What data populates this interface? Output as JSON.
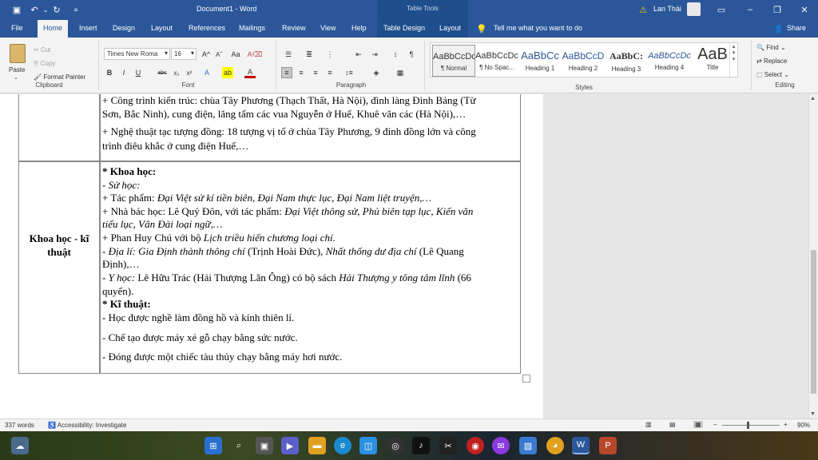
{
  "window": {
    "title": "Document1 - Word",
    "context_tab": "Table Tools",
    "user": "Lan Thái"
  },
  "tabs": [
    "File",
    "Home",
    "Insert",
    "Design",
    "Layout",
    "References",
    "Mailings",
    "Review",
    "View",
    "Help",
    "Table Design",
    "Layout"
  ],
  "tell_me": "Tell me what you want to do",
  "share": "Share",
  "clipboard": {
    "paste": "Paste",
    "cut": "Cut",
    "copy": "Copy",
    "format_painter": "Format Painter",
    "label": "Clipboard"
  },
  "font": {
    "name": "Times New Roma",
    "size": "16",
    "label": "Font"
  },
  "paragraph": {
    "label": "Paragraph"
  },
  "styles": {
    "items": [
      {
        "preview": "AaBbCcDc",
        "name": "¶ Normal"
      },
      {
        "preview": "AaBbCcDc",
        "name": "¶ No Spac..."
      },
      {
        "preview": "AaBbCc",
        "name": "Heading 1"
      },
      {
        "preview": "AaBbCcD",
        "name": "Heading 2"
      },
      {
        "preview": "AaBbC:",
        "name": "Heading 3"
      },
      {
        "preview": "AaBbCcDc",
        "name": "Heading 4"
      },
      {
        "preview": "AaB",
        "name": "Title"
      }
    ],
    "label": "Styles"
  },
  "editing": {
    "find": "Find",
    "replace": "Replace",
    "select": "Select",
    "label": "Editing"
  },
  "doc": {
    "top_lines": [
      "+ Công trình kiến trúc: chùa Tây Phương (Thạch Thất, Hà Nội), đình làng Đình Bảng (Từ",
      "Sơn, Bắc Ninh), cung điện, lăng tẩm các vua Nguyễn ở Huế, Khuê văn các (Hà Nội),…",
      "+ Nghệ thuật tạc tượng đồng: 18 tượng vị tổ ở chùa Tây Phương, 9 đỉnh đồng lớn và công",
      "trình điêu khắc ở cung điện Huế,…"
    ],
    "left_cell": [
      "Khoa học - kĩ",
      "thuật"
    ],
    "science_heading": "* Khoa học:",
    "sub_history": "- Sử học:",
    "works_label": "+ Tác phẩm:",
    "works": " Đại Việt sử kí tiền biên, Đại Nam thực lục, Đại Nam liệt truyện,…",
    "scholar_label": "+ Nhà bác học: Lê Quý Đôn, với tác phẩm:",
    "scholar_works": " Đại Việt thông sử, Phủ biên tạp lục, Kiến văn",
    "scholar_works2": "tiểu lục, Vân Đài loại ngữ,…",
    "phan_prefix": "+ Phan Huy Chú với bộ ",
    "phan_work": "Lịch triều hiến chương loại chí.",
    "geo_prefix": "- Địa lí: Gia Định thành thông chí",
    "geo_mid": " (Trịnh Hoài Đức), ",
    "geo_work": "Nhất thống dư địa chí",
    "geo_end": " (Lê Quang",
    "geo_line2": "Định),…",
    "med_prefix": "- Y học:",
    "med_mid": " Lê Hữu Trác (Hải Thượng Lãn Ông) có bộ sách ",
    "med_work": "Hải Thượng y tông tâm lĩnh",
    "med_end": " (66",
    "med_line2": "quyển).",
    "tech_heading": "* Kĩ thuật:",
    "tech_lines": [
      "- Học được nghề làm đồng hồ và kính thiên lí.",
      "- Chế tạo được máy xẻ gỗ chạy bằng sức nước.",
      "- Đóng được một chiếc tàu thủy chạy bằng máy hơi nước."
    ]
  },
  "status": {
    "words": "337 words",
    "accessibility": "Accessibility: Investigate",
    "zoom": "90%"
  }
}
